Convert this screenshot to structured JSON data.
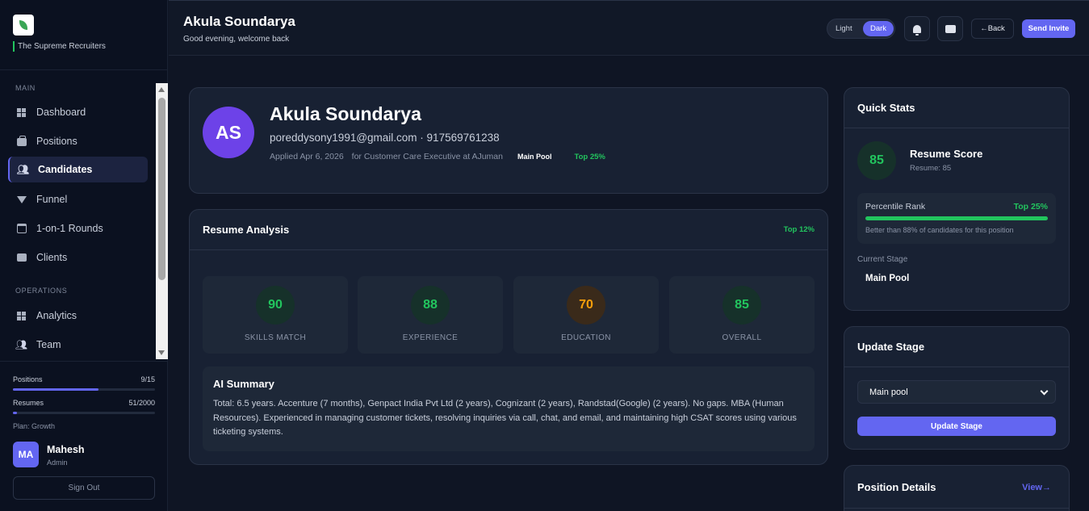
{
  "brand": {
    "name": "The Supreme Recruiters"
  },
  "nav": {
    "section_main": "MAIN",
    "section_operations": "OPERATIONS",
    "items": [
      {
        "label": "Dashboard",
        "icon": "dashboard-icon"
      },
      {
        "label": "Positions",
        "icon": "briefcase-icon"
      },
      {
        "label": "Candidates",
        "icon": "people-icon",
        "active": true
      },
      {
        "label": "Funnel",
        "icon": "funnel-icon"
      },
      {
        "label": "1-on-1 Rounds",
        "icon": "calendar-icon"
      },
      {
        "label": "Clients",
        "icon": "chat-icon"
      },
      {
        "label": "Analytics",
        "icon": "dashboard-icon"
      },
      {
        "label": "Team",
        "icon": "people-icon"
      }
    ]
  },
  "usage": {
    "positions_label": "Positions",
    "positions_value": "9/15",
    "positions_fraction": 0.6,
    "resumes_label": "Resumes",
    "resumes_value": "51/2000",
    "resumes_fraction": 0.026,
    "plan": "Plan: Growth"
  },
  "user": {
    "initials": "MA",
    "name": "Mahesh",
    "role": "Admin",
    "signout": "Sign Out"
  },
  "header": {
    "title": "Akula Soundarya",
    "subtitle": "Good evening, welcome back",
    "theme_light": "Light",
    "theme_dark": "Dark",
    "back": "←Back",
    "invite": "Send Invite"
  },
  "profile": {
    "initials": "AS",
    "name": "Akula Soundarya",
    "contact": "poreddysony1991@gmail.com · 917569761238",
    "applied": "Applied Apr 6, 2026",
    "role": "for Customer Care Executive at AJuman",
    "pool": "Main Pool",
    "rank": "Top 25%"
  },
  "analysis": {
    "title": "Resume Analysis",
    "badge": "Top 12%",
    "scores": [
      {
        "value": "90",
        "label": "SKILLS MATCH",
        "color": "green"
      },
      {
        "value": "88",
        "label": "EXPERIENCE",
        "color": "green"
      },
      {
        "value": "70",
        "label": "EDUCATION",
        "color": "orange"
      },
      {
        "value": "85",
        "label": "OVERALL",
        "color": "green"
      }
    ],
    "summary_title": "AI Summary",
    "summary_text": "Total: 6.5 years. Accenture (7 months), Genpact India Pvt Ltd (2 years), Cognizant (2 years), Randstad(Google) (2 years). No gaps. MBA (Human Resources). Experienced in managing customer tickets, resolving inquiries via call, chat, and email, and maintaining high CSAT scores using various ticketing systems."
  },
  "quick_stats": {
    "title": "Quick Stats",
    "score": "85",
    "score_title": "Resume Score",
    "score_sub": "Resume: 85",
    "percentile_label": "Percentile Rank",
    "percentile_value": "Top 25%",
    "percentile_fraction": 1.0,
    "percentile_note": "Better than 88% of candidates for this position",
    "stage_label": "Current Stage",
    "stage_value": "Main Pool"
  },
  "update_stage": {
    "title": "Update Stage",
    "selected": "Main pool",
    "button": "Update Stage"
  },
  "position_details": {
    "title": "Position Details",
    "view": "View→"
  },
  "colors": {
    "accent": "#6366f1",
    "success": "#22c55e",
    "warning": "#f59e0b"
  }
}
